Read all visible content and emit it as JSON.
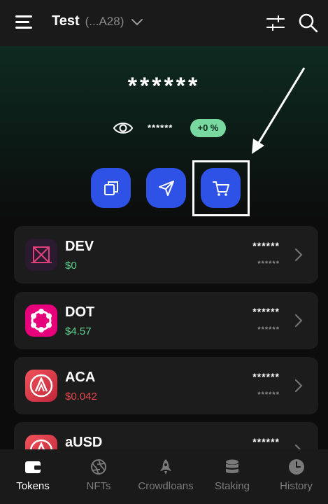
{
  "header": {
    "account_name": "Test",
    "account_address": "(...A28)",
    "icons": [
      "menu-icon",
      "chevron-down-icon",
      "sliders-icon",
      "search-icon"
    ]
  },
  "summary": {
    "balance_hidden": "******",
    "sub_balance_hidden": "******",
    "change_badge": "+0 %"
  },
  "actions": [
    {
      "name": "receive",
      "icon": "copy-icon"
    },
    {
      "name": "send",
      "icon": "send-icon"
    },
    {
      "name": "buy",
      "icon": "cart-icon"
    }
  ],
  "tokens": [
    {
      "symbol": "DEV",
      "value": "$0",
      "balance": "******",
      "balance_sub": "******",
      "value_color": "#5fd38f",
      "logo": "dev-logo"
    },
    {
      "symbol": "DOT",
      "value": "$4.57",
      "balance": "******",
      "balance_sub": "******",
      "value_color": "#5fd38f",
      "logo": "polkadot-logo"
    },
    {
      "symbol": "ACA",
      "value": "$0.042",
      "balance": "******",
      "balance_sub": "******",
      "value_color": "#e5484d",
      "logo": "acala-logo"
    },
    {
      "symbol": "aUSD",
      "value": "",
      "balance": "******",
      "balance_sub": "",
      "value_color": "#5fd38f",
      "logo": "acala-logo"
    }
  ],
  "nav": [
    {
      "label": "Tokens",
      "icon": "wallet-icon",
      "active": true
    },
    {
      "label": "NFTs",
      "icon": "aperture-icon",
      "active": false
    },
    {
      "label": "Crowdloans",
      "icon": "rocket-icon",
      "active": false
    },
    {
      "label": "Staking",
      "icon": "database-icon",
      "active": false
    },
    {
      "label": "History",
      "icon": "clock-icon",
      "active": false
    }
  ],
  "colors": {
    "accent": "#2e52e6",
    "positive": "#5fd38f",
    "negative": "#e5484d",
    "badge_bg": "#79d8a0"
  }
}
